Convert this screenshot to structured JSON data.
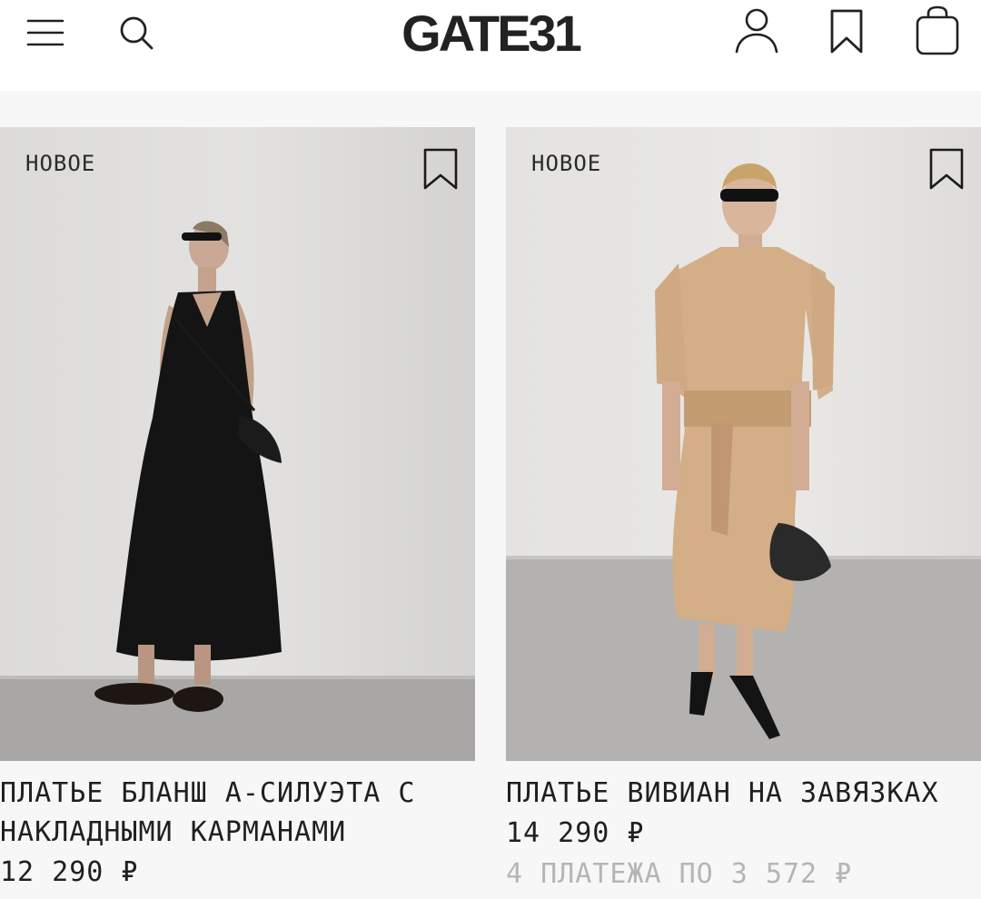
{
  "header": {
    "logo": "GATE31",
    "icons": [
      "menu-icon",
      "search-icon",
      "account-icon",
      "bookmark-icon",
      "bag-icon"
    ]
  },
  "products": [
    {
      "badge": "НОВОЕ",
      "title": "ПЛАТЬЕ БЛАНШ А-СИЛУЭТА С НАКЛАДНЫМИ КАРМАНАМИ",
      "price": "12 290 ₽",
      "installment": ""
    },
    {
      "badge": "НОВОЕ",
      "title": "ПЛАТЬЕ ВИВИАН НА ЗАВЯЗКАХ",
      "price": "14 290 ₽",
      "installment": "4 ПЛАТЕЖА ПО 3 572 ₽"
    }
  ],
  "colors": {
    "page_bg": "#f7f7f7",
    "header_bg": "#ffffff",
    "text": "#1f1f1f",
    "muted": "#b5b5b5"
  }
}
